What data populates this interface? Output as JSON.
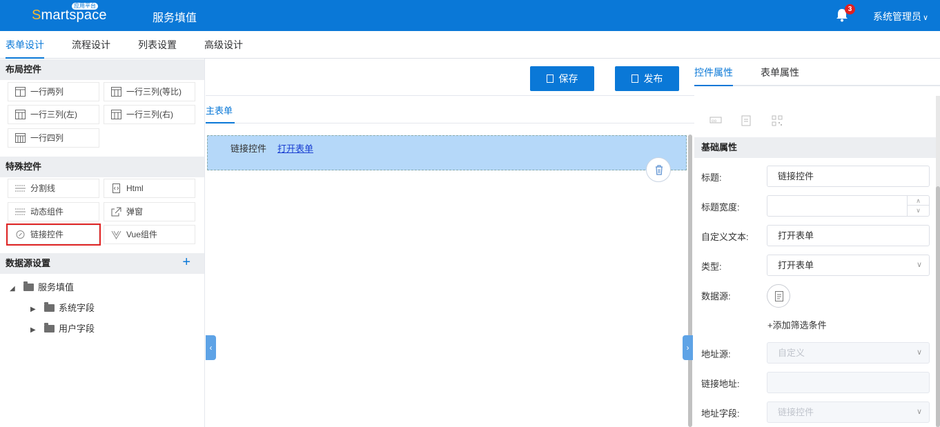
{
  "header": {
    "logo_text_s": "S",
    "logo_text_rest": "martspace",
    "logo_badge": "应用平台",
    "title": "服务填值",
    "notification_count": "3",
    "user": "系统管理员"
  },
  "tabs": [
    {
      "label": "表单设计",
      "active": true
    },
    {
      "label": "流程设计"
    },
    {
      "label": "列表设置"
    },
    {
      "label": "高级设计"
    }
  ],
  "left": {
    "layout_title": "布局控件",
    "layout_items": [
      "一行两列",
      "一行三列(等比)",
      "一行三列(左)",
      "一行三列(右)",
      "一行四列"
    ],
    "special_title": "特殊控件",
    "special_items": [
      "分割线",
      "Html",
      "动态组件",
      "弹窗",
      "链接控件",
      "Vue组件"
    ],
    "datasource_title": "数据源设置",
    "tree": {
      "root": "服务填值",
      "children": [
        "系统字段",
        "用户字段"
      ]
    }
  },
  "center": {
    "save_label": "保存",
    "publish_label": "发布",
    "sub_tab": "主表单",
    "row_label": "链接控件",
    "row_link": "打开表单"
  },
  "right": {
    "tabs": [
      "控件属性",
      "表单属性"
    ],
    "section": "基础属性",
    "fields": {
      "title_label": "标题:",
      "title_value": "链接控件",
      "title_width_label": "标题宽度:",
      "title_width_value": "",
      "custom_text_label": "自定义文本:",
      "custom_text_value": "打开表单",
      "type_label": "类型:",
      "type_value": "打开表单",
      "datasource_label": "数据源:",
      "add_filter": "+添加筛选条件",
      "addr_source_label": "地址源:",
      "addr_source_value": "自定义",
      "link_addr_label": "链接地址:",
      "link_addr_value": "",
      "addr_field_label": "地址字段:",
      "addr_field_value": "链接控件"
    }
  },
  "colors": {
    "primary": "#0a78d7",
    "selected_row": "#b5d8f9",
    "highlight_border": "#e02424"
  }
}
